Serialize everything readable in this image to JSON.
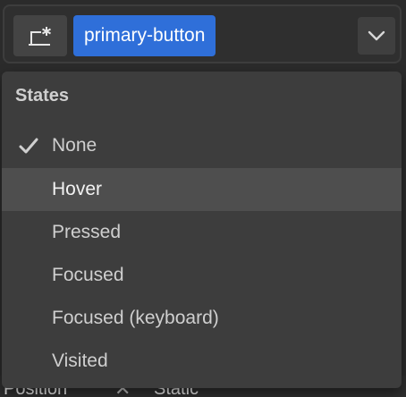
{
  "background_panel": {
    "label": "Position",
    "value": "Static"
  },
  "selector": {
    "state_icon": "state-selector-icon",
    "class_name": "primary-button",
    "chevron_icon": "chevron-down-icon"
  },
  "dropdown": {
    "heading": "States",
    "items": [
      {
        "label": "None",
        "selected": true
      },
      {
        "label": "Hover",
        "hovered": true
      },
      {
        "label": "Pressed"
      },
      {
        "label": "Focused"
      },
      {
        "label": "Focused (keyboard)"
      },
      {
        "label": "Visited"
      }
    ]
  },
  "colors": {
    "accent": "#2f6fd9",
    "menu_bg": "#3d3d3d",
    "hover_bg": "#4e4e4e"
  }
}
